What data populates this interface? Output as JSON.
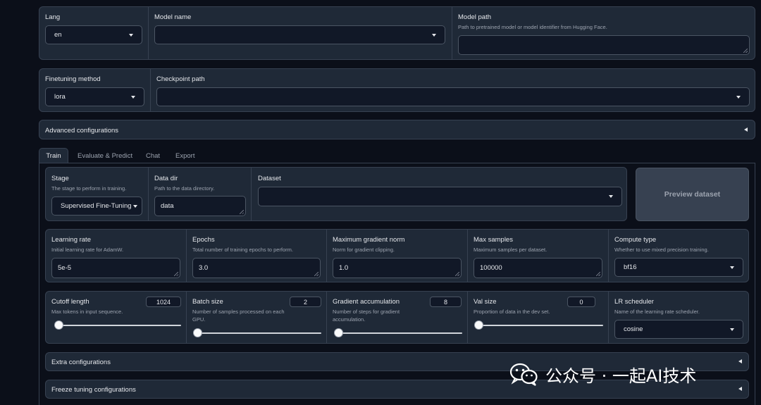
{
  "top": {
    "lang": {
      "label": "Lang",
      "value": "en"
    },
    "model_name": {
      "label": "Model name",
      "value": ""
    },
    "model_path": {
      "label": "Model path",
      "info": "Path to pretrained model or model identifier from Hugging Face.",
      "value": ""
    }
  },
  "method": {
    "finetuning": {
      "label": "Finetuning method",
      "value": "lora"
    },
    "checkpoint": {
      "label": "Checkpoint path",
      "value": ""
    }
  },
  "advanced": {
    "label": "Advanced configurations"
  },
  "tabs": [
    {
      "label": "Train",
      "active": true
    },
    {
      "label": "Evaluate & Predict",
      "active": false
    },
    {
      "label": "Chat",
      "active": false
    },
    {
      "label": "Export",
      "active": false
    }
  ],
  "train": {
    "stage": {
      "label": "Stage",
      "info": "The stage to perform in training.",
      "value": "Supervised Fine-Tuning"
    },
    "data_dir": {
      "label": "Data dir",
      "info": "Path to the data directory.",
      "value": "data"
    },
    "dataset": {
      "label": "Dataset",
      "value": ""
    },
    "preview_button": "Preview dataset",
    "learning_rate": {
      "label": "Learning rate",
      "info": "Initial learning rate for AdamW.",
      "value": "5e-5"
    },
    "epochs": {
      "label": "Epochs",
      "info": "Total number of training epochs to perform.",
      "value": "3.0"
    },
    "max_grad_norm": {
      "label": "Maximum gradient norm",
      "info": "Norm for gradient clipping.",
      "value": "1.0"
    },
    "max_samples": {
      "label": "Max samples",
      "info": "Maximum samples per dataset.",
      "value": "100000"
    },
    "compute_type": {
      "label": "Compute type",
      "info": "Whether to use mixed precision training.",
      "value": "bf16"
    },
    "cutoff_len": {
      "label": "Cutoff length",
      "info": "Max tokens in input sequence.",
      "value": "1024"
    },
    "batch_size": {
      "label": "Batch size",
      "info": "Number of samples processed on each GPU.",
      "value": "2"
    },
    "grad_accum": {
      "label": "Gradient accumulation",
      "info": "Number of steps for gradient accumulation.",
      "value": "8"
    },
    "val_size": {
      "label": "Val size",
      "info": "Proportion of data in the dev set.",
      "value": "0"
    },
    "lr_scheduler": {
      "label": "LR scheduler",
      "info": "Name of the learning rate scheduler.",
      "value": "cosine"
    },
    "extra": {
      "label": "Extra configurations"
    },
    "freeze": {
      "label": "Freeze tuning configurations"
    }
  },
  "watermark": {
    "text": "公众号 · 一起AI技术"
  },
  "colors": {
    "background": "#0b0f19",
    "panel": "#1f2937",
    "border": "#374151",
    "input": "#111827"
  }
}
